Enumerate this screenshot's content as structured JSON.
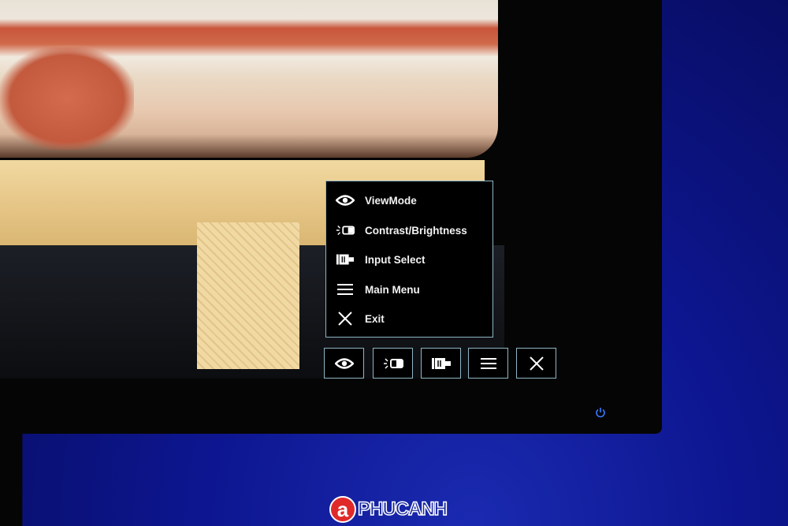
{
  "osd_menu": {
    "items": [
      {
        "label": "ViewMode",
        "icon": "eye-icon"
      },
      {
        "label": "Contrast/Brightness",
        "icon": "contrast-brightness-icon"
      },
      {
        "label": "Input Select",
        "icon": "input-select-icon"
      },
      {
        "label": "Main Menu",
        "icon": "hamburger-menu-icon"
      },
      {
        "label": "Exit",
        "icon": "close-icon"
      }
    ],
    "border_color": "#8fb6c6"
  },
  "hotkeys": [
    "eye-icon",
    "contrast-brightness-icon",
    "input-select-icon",
    "hamburger-menu-icon",
    "close-icon"
  ],
  "power_led_color": "#3a7bff",
  "watermark": "PHUCANH"
}
